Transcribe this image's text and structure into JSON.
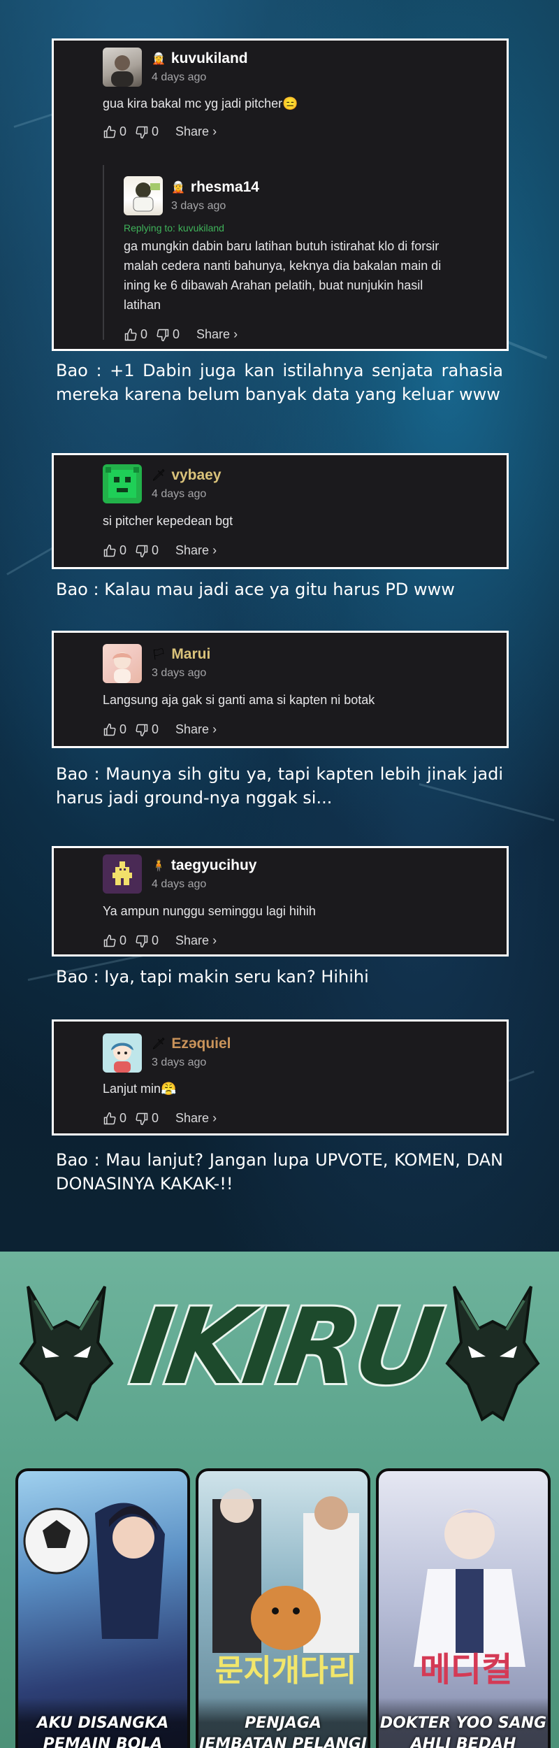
{
  "comments": [
    {
      "username": "kuvukiland",
      "rank_icon": "🧝",
      "time_ago": "4 days ago",
      "text": "gua kira bakal mc yg jadi pitcher😑",
      "likes": "0",
      "dislikes": "0",
      "share_label": "Share ›",
      "reply": {
        "username": "rhesma14",
        "rank_icon": "🧝",
        "time_ago": "3 days ago",
        "replying_to": "Replying to: kuvukiland",
        "text": "ga mungkin dabin baru latihan butuh istirahat klo di forsir malah cedera nanti bahunya, keknya dia bakalan main di ining ke 6 dibawah Arahan pelatih, buat nunjukin hasil latihan",
        "likes": "0",
        "dislikes": "0",
        "share_label": "Share ›"
      }
    },
    {
      "username": "vybaey",
      "rank_icon": "🗡",
      "time_ago": "4 days ago",
      "text": "si pitcher kepedean bgt",
      "likes": "0",
      "dislikes": "0",
      "share_label": "Share ›"
    },
    {
      "username": "Marui",
      "rank_icon": "🏳",
      "time_ago": "3 days ago",
      "text": "Langsung aja gak si ganti ama si kapten ni botak",
      "likes": "0",
      "dislikes": "0",
      "share_label": "Share ›"
    },
    {
      "username": "taegyucihuy",
      "rank_icon": "🧍",
      "time_ago": "4 days ago",
      "text": "Ya ampun nunggu seminggu lagi hihih",
      "likes": "0",
      "dislikes": "0",
      "share_label": "Share ›"
    },
    {
      "username": "Ezəquiel",
      "rank_icon": "🗡",
      "time_ago": "3 days ago",
      "text": "Lanjut min😤",
      "likes": "0",
      "dislikes": "0",
      "share_label": "Share ›"
    }
  ],
  "bao_replies": [
    "Bao : +1 Dabin juga kan istilahnya senjata rahasia mereka karena belum banyak data yang keluar www",
    "Bao : Kalau mau jadi ace ya gitu harus PD www",
    "Bao : Maunya sih gitu ya, tapi kapten lebih jinak jadi harus jadi ground-nya nggak si...",
    "Bao : Iya, tapi makin seru kan? Hihihi",
    "Bao : Mau lanjut? Jangan lupa UPVOTE, KOMEN, DAN DONASINYA KAKAK-!!"
  ],
  "promo": {
    "logo_text": "IKIRU",
    "posters": [
      {
        "title": "AKU DISANGKA PEMAIN BOLA YANG JENIUS"
      },
      {
        "title": "PENJAGA JEMBATAN PELANGI"
      },
      {
        "title": "DOKTER YOO SANG AHLI BEDAH"
      }
    ]
  },
  "colors": {
    "card_bg": "#1b1a1d",
    "card_border": "#ffffff",
    "reply_green": "#3fb35a",
    "promo_green": "#58a189",
    "logo_green": "#1d4a2c"
  }
}
